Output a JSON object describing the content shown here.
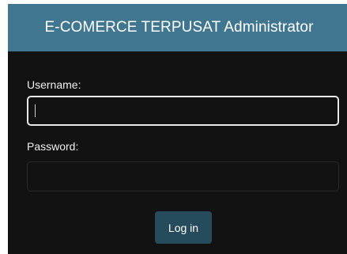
{
  "header": {
    "title": "E-COMERCE TERPUSAT Administrator"
  },
  "form": {
    "username_label": "Username:",
    "username_value": "",
    "password_label": "Password:",
    "password_value": "",
    "submit_label": "Log in"
  },
  "colors": {
    "header_bg": "#417690",
    "panel_bg": "#121212",
    "button_bg": "#264b5d",
    "text": "#f0f0f0"
  }
}
